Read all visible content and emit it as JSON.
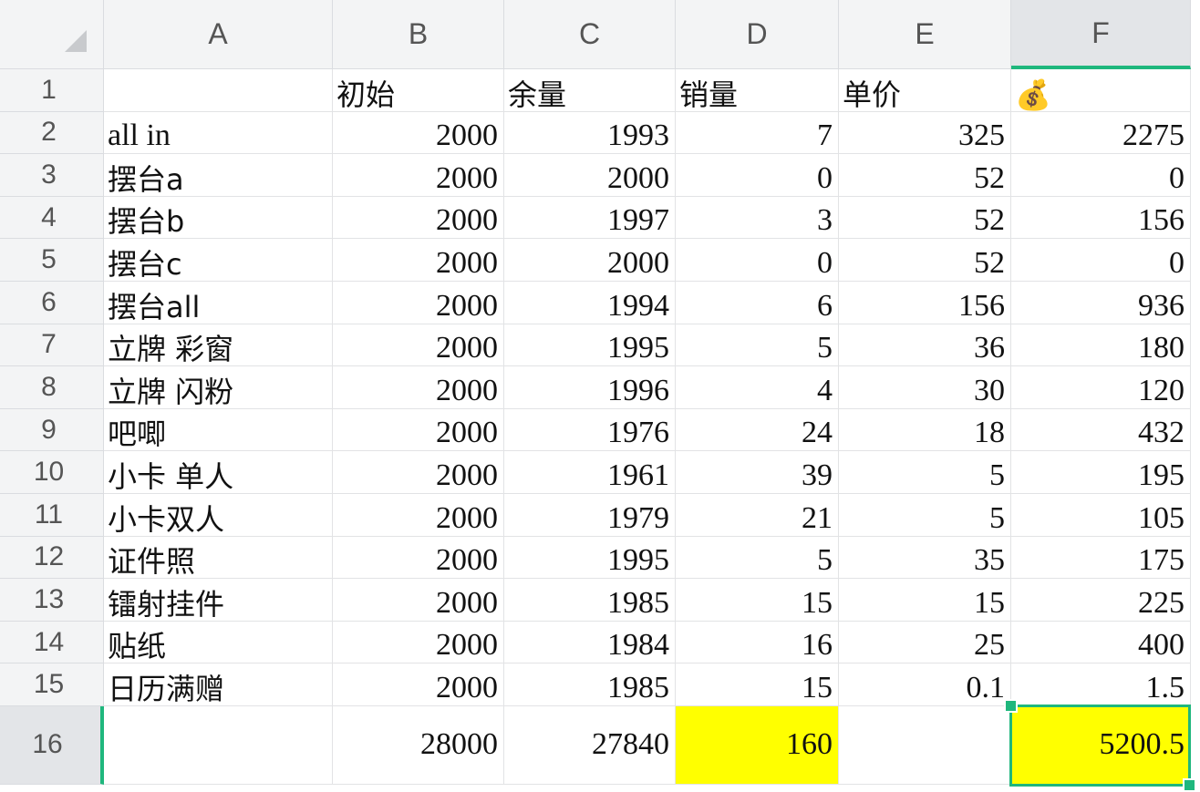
{
  "columns": [
    "A",
    "B",
    "C",
    "D",
    "E",
    "F"
  ],
  "selected_column": "F",
  "selected_row": "16",
  "rows": [
    {
      "num": "1",
      "a": "",
      "b": "初始",
      "c": "余量",
      "d": "销量",
      "e": "单价",
      "f": "💰"
    },
    {
      "num": "2",
      "a": "all in",
      "b": "2000",
      "c": "1993",
      "d": "7",
      "e": "325",
      "f": "2275"
    },
    {
      "num": "3",
      "a": "摆台a",
      "b": "2000",
      "c": "2000",
      "d": "0",
      "e": "52",
      "f": "0"
    },
    {
      "num": "4",
      "a": "摆台b",
      "b": "2000",
      "c": "1997",
      "d": "3",
      "e": "52",
      "f": "156"
    },
    {
      "num": "5",
      "a": "摆台c",
      "b": "2000",
      "c": "2000",
      "d": "0",
      "e": "52",
      "f": "0"
    },
    {
      "num": "6",
      "a": "摆台all",
      "b": "2000",
      "c": "1994",
      "d": "6",
      "e": "156",
      "f": "936"
    },
    {
      "num": "7",
      "a": "立牌 彩窗",
      "b": "2000",
      "c": "1995",
      "d": "5",
      "e": "36",
      "f": "180"
    },
    {
      "num": "8",
      "a": "立牌 闪粉",
      "b": "2000",
      "c": "1996",
      "d": "4",
      "e": "30",
      "f": "120"
    },
    {
      "num": "9",
      "a": "吧唧",
      "b": "2000",
      "c": "1976",
      "d": "24",
      "e": "18",
      "f": "432"
    },
    {
      "num": "10",
      "a": "小卡 单人",
      "b": "2000",
      "c": "1961",
      "d": "39",
      "e": "5",
      "f": "195"
    },
    {
      "num": "11",
      "a": "小卡双人",
      "b": "2000",
      "c": "1979",
      "d": "21",
      "e": "5",
      "f": "105"
    },
    {
      "num": "12",
      "a": "证件照",
      "b": "2000",
      "c": "1995",
      "d": "5",
      "e": "35",
      "f": "175"
    },
    {
      "num": "13",
      "a": "镭射挂件",
      "b": "2000",
      "c": "1985",
      "d": "15",
      "e": "15",
      "f": "225"
    },
    {
      "num": "14",
      "a": "贴纸",
      "b": "2000",
      "c": "1984",
      "d": "16",
      "e": "25",
      "f": "400"
    },
    {
      "num": "15",
      "a": "日历满赠",
      "b": "2000",
      "c": "1985",
      "d": "15",
      "e": "0.1",
      "f": "1.5"
    },
    {
      "num": "16",
      "a": "",
      "b": "28000",
      "c": "27840",
      "d": "160",
      "e": "",
      "f": "5200.5"
    }
  ],
  "colors": {
    "highlight": "#ffff00",
    "selection": "#1fb77d",
    "header_bg": "#f3f4f5"
  }
}
